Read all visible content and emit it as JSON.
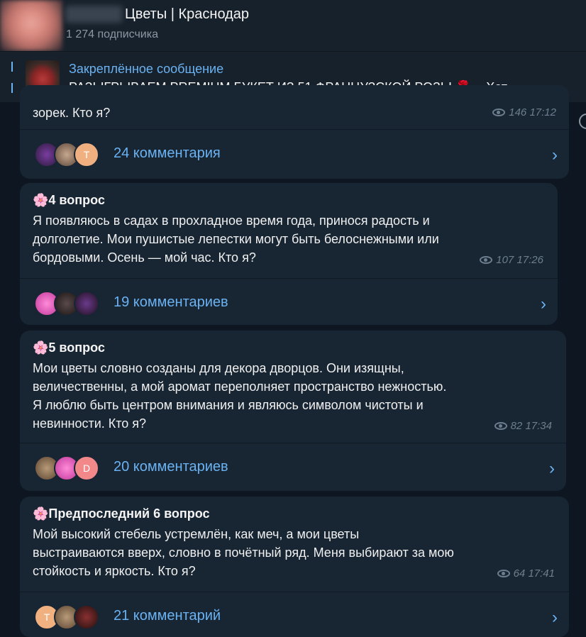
{
  "header": {
    "title": "Цветы | Краснодар",
    "subscribers": "1 274 подписчика"
  },
  "pinned": {
    "title": "Закреплённое сообщение",
    "text": "РАЗЫГРЫВАЕМ PREMIUM БУКЕТ ИЗ 51 ФРАНЦУЗСКОЙ РОЗЫ",
    "emoji": "🌹",
    "overflow": "Хот"
  },
  "posts": [
    {
      "head": "",
      "body_lines": [
        "зорек. Кто я?"
      ],
      "views": "146",
      "time": "17:12",
      "comments": "24 комментария",
      "avatars": [
        "",
        "",
        "T"
      ]
    },
    {
      "head": "4 вопрос",
      "body_lines": [
        "Я появляюсь в садах в прохладное время года, принося радость и",
        "долголетие. Мои пушистые лепестки могут быть белоснежными или",
        "бордовыми. Осень — мой час. Кто я?"
      ],
      "views": "107",
      "time": "17:26",
      "comments": "19 комментариев",
      "avatars": [
        "",
        "",
        ""
      ]
    },
    {
      "head": "5 вопрос",
      "body_lines": [
        "Мои цветы словно созданы для декора дворцов. Они изящны,",
        "величественны, а мой аромат переполняет пространство нежностью.",
        "Я люблю быть центром внимания и являюсь символом чистоты и",
        "невинности. Кто я?"
      ],
      "views": "82",
      "time": "17:34",
      "comments": "20 комментариев",
      "avatars": [
        "",
        "",
        "D"
      ]
    },
    {
      "head": "Предпоследний 6 вопрос",
      "body_lines": [
        "Мой высокий стебель устремлён, как меч, а мои цветы",
        "выстраиваются вверх, словно в почётный ряд. Меня выбирают за мою",
        "стойкость и яркость. Кто я?"
      ],
      "views": "64",
      "time": "17:41",
      "comments": "21 комментарий",
      "avatars": [
        "T",
        "",
        ""
      ]
    }
  ],
  "icons": {
    "flower": "🌸",
    "views": "eye-icon",
    "chevron": "›"
  }
}
